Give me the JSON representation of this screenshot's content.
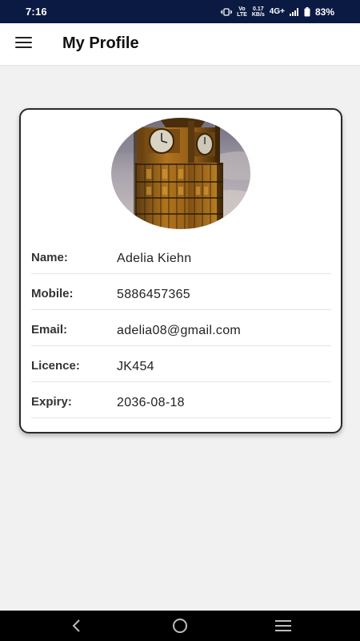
{
  "status_bar": {
    "time": "7:16",
    "volte_top": "Vo",
    "volte_bottom": "LTE",
    "speed_top": "0.17",
    "speed_bottom": "KB/s",
    "network": "4G+",
    "battery": "83%",
    "battery_level": 0.83
  },
  "app_bar": {
    "title": "My Profile",
    "menu_icon": "hamburger-menu-icon"
  },
  "profile": {
    "avatar": "big-ben-clock-tower-photo",
    "fields": [
      {
        "label": "Name:",
        "value": "Adelia Kiehn"
      },
      {
        "label": "Mobile:",
        "value": "5886457365"
      },
      {
        "label": "Email:",
        "value": "adelia08@gmail.com"
      },
      {
        "label": "Licence:",
        "value": "JK454"
      },
      {
        "label": "Expiry:",
        "value": "2036-08-18"
      }
    ]
  },
  "nav_bar": {
    "back_icon": "back-chevron-icon",
    "home_icon": "home-circle-icon",
    "recents_icon": "recents-menu-icon"
  },
  "colors": {
    "status_bar_bg": "#0b1a42",
    "page_bg": "#f1f1f1",
    "card_border": "#2a2a2a",
    "nav_bar_bg": "#000000"
  }
}
